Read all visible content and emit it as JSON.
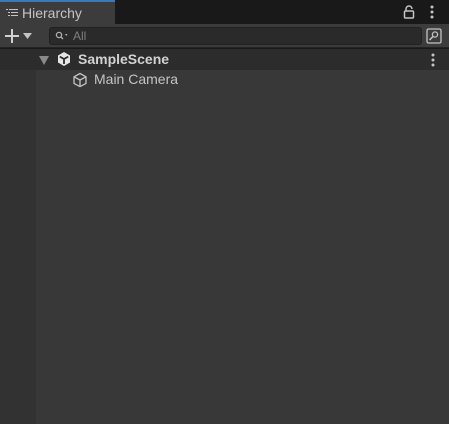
{
  "window": {
    "tab_label": "Hierarchy"
  },
  "toolbar": {
    "search_placeholder": "All"
  },
  "hierarchy": {
    "scene_name": "SampleScene",
    "items": [
      {
        "label": "Main Camera"
      }
    ]
  },
  "colors": {
    "accent": "#3a79bb",
    "panel_bg": "#383838",
    "toolbar_bg": "#3c3c3c",
    "scene_row_bg": "#2c2c2c",
    "text": "#c4c4c4"
  }
}
